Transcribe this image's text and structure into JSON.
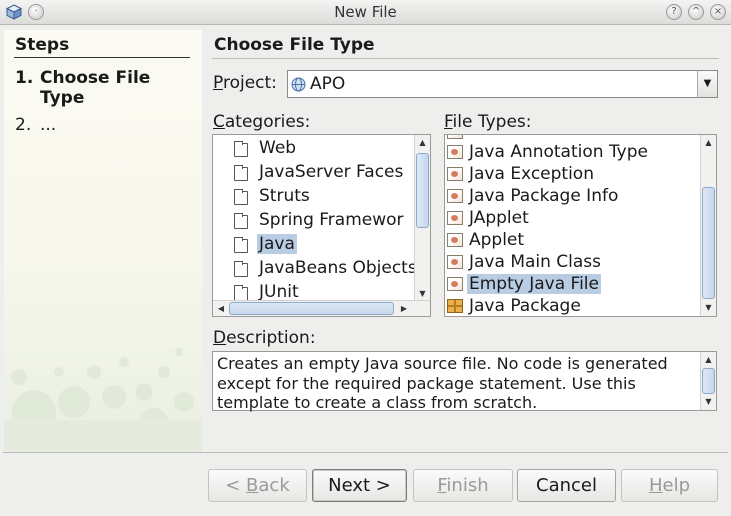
{
  "window": {
    "title": "New File"
  },
  "steps": {
    "heading": "Steps",
    "items": [
      {
        "num": "1.",
        "label": "Choose File Type"
      },
      {
        "num": "2.",
        "label": "..."
      }
    ]
  },
  "panel": {
    "title": "Choose File Type"
  },
  "project": {
    "label_mnemonic": "P",
    "label_rest": "roject:",
    "value": "APO"
  },
  "categories": {
    "label_mnemonic": "C",
    "label_rest": "ategories:",
    "items": [
      "Web",
      "JavaServer Faces",
      "Struts",
      "Spring Framewor",
      "Java",
      "JavaBeans Objects",
      "JUnit"
    ],
    "selected": "Java"
  },
  "file_types": {
    "label_mnemonic": "F",
    "label_rest": "ile Types:",
    "items": [
      "Java Annotation Type",
      "Java Exception",
      "Java Package Info",
      "JApplet",
      "Applet",
      "Java Main Class",
      "Empty Java File",
      "Java Package"
    ],
    "selected": "Empty Java File"
  },
  "description": {
    "label_mnemonic": "D",
    "label_rest": "escription:",
    "lines": [
      "Creates an empty Java source file. No code is generated",
      "except for the required package statement. Use this",
      "template to create a class from scratch."
    ]
  },
  "buttons": {
    "back_prefix": "< ",
    "back_mnemonic": "B",
    "back_rest": "ack",
    "next": "Next >",
    "finish_mnemonic": "F",
    "finish_rest": "inish",
    "cancel": "Cancel",
    "help_mnemonic": "H",
    "help_rest": "elp"
  },
  "colors": {
    "selection": "#b8cde4",
    "scroll_thumb": "#c6d7ec"
  }
}
